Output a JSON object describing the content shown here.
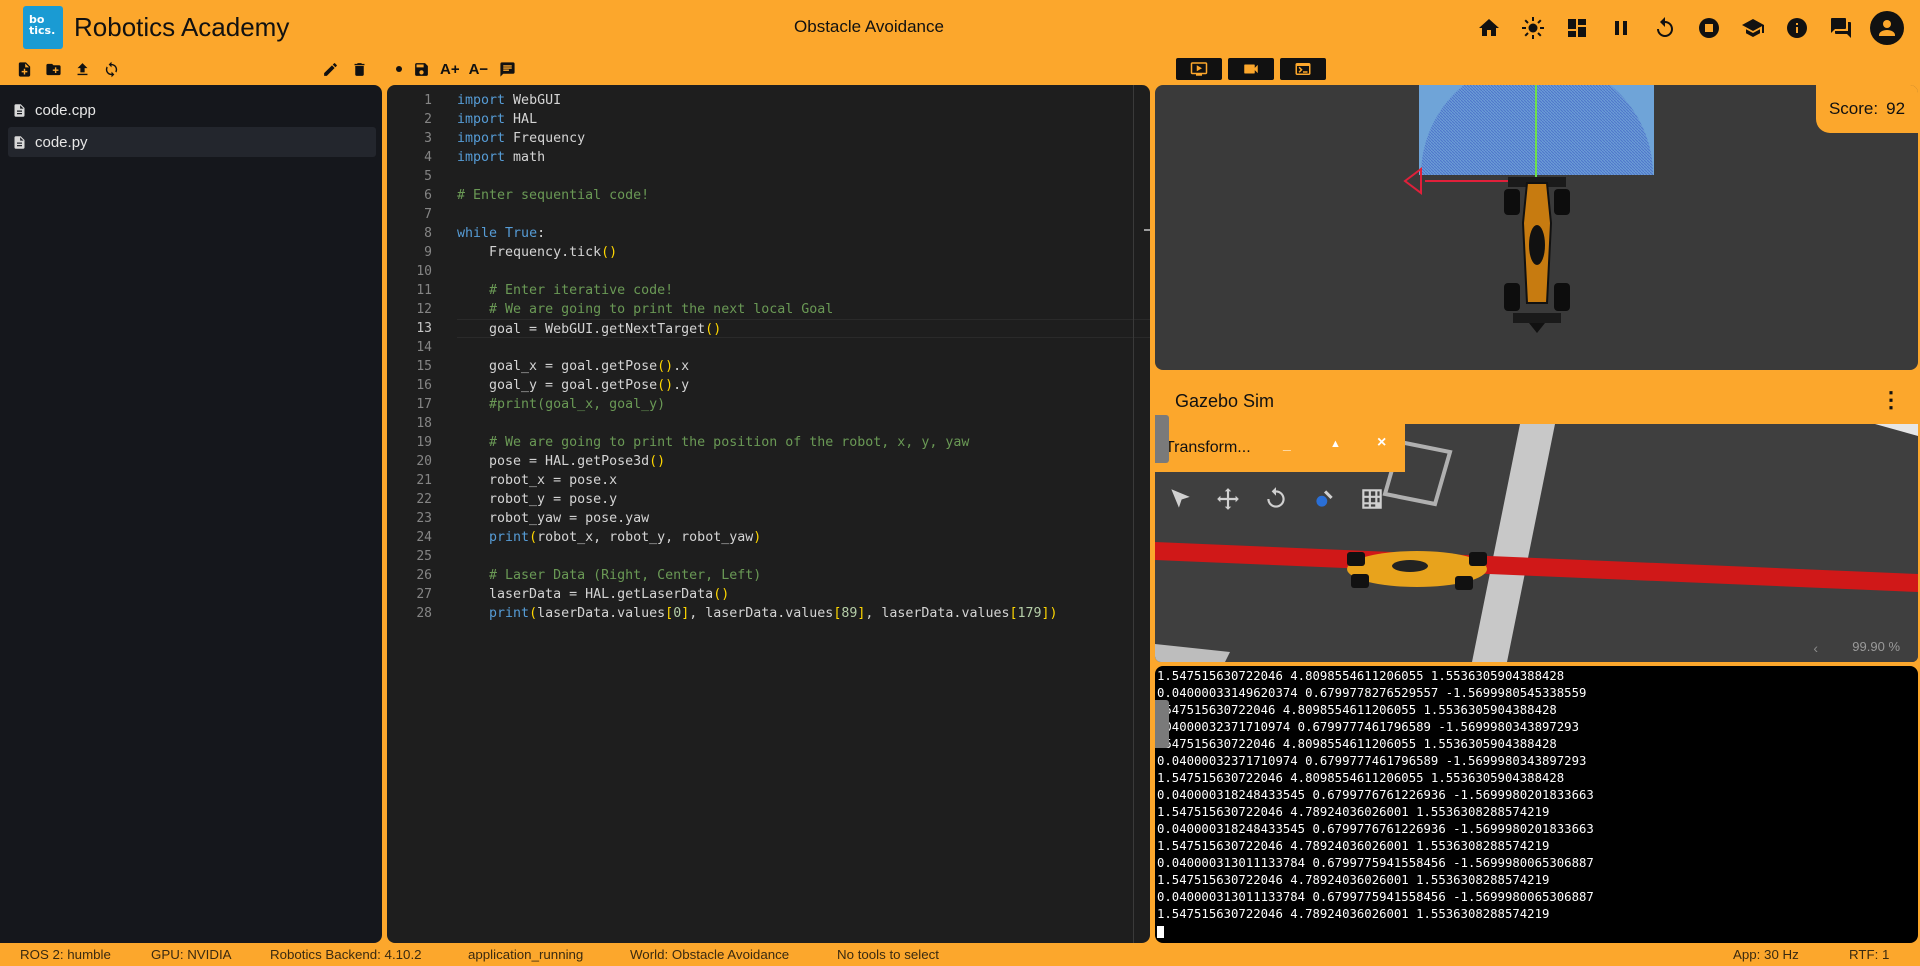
{
  "header": {
    "logo_text": [
      "bo",
      "tics."
    ],
    "app_title": "Robotics Academy",
    "exercise_title": "Obstacle Avoidance",
    "icons": [
      "home-icon",
      "theme-brightness-icon",
      "layout-dashboard-icon",
      "pause-icon",
      "reset-icon",
      "stop-icon",
      "school-icon",
      "info-icon",
      "forum-icon",
      "account-icon"
    ]
  },
  "explorer": {
    "toolbar_icons": [
      "new-file-icon",
      "new-folder-icon",
      "upload-icon",
      "refresh-icon"
    ],
    "right_icons": [
      "edit-icon",
      "delete-icon"
    ],
    "files": [
      {
        "name": "code.cpp",
        "active": false
      },
      {
        "name": "code.py",
        "active": true
      }
    ]
  },
  "editor": {
    "toolbar": {
      "font_increase": "A+",
      "font_decrease": "A−"
    },
    "current_line": 13,
    "lines": [
      "import WebGUI",
      "import HAL",
      "import Frequency",
      "import math",
      "",
      "# Enter sequential code!",
      "",
      "while True:",
      "    Frequency.tick()",
      "",
      "    # Enter iterative code!",
      "    # We are going to print the next local Goal",
      "    goal = WebGUI.getNextTarget()",
      "",
      "    goal_x = goal.getPose().x",
      "    goal_y = goal.getPose().y",
      "    #print(goal_x, goal_y)",
      "",
      "    # We are going to print the position of the robot, x, y, yaw",
      "    pose = HAL.getPose3d()",
      "    robot_x = pose.x",
      "    robot_y = pose.y",
      "    robot_yaw = pose.yaw",
      "    print(robot_x, robot_y, robot_yaw)",
      "",
      "    # Laser Data (Right, Center, Left)",
      "    laserData = HAL.getLaserData()",
      "    print(laserData.values[0], laserData.values[89], laserData.values[179])"
    ]
  },
  "view_toolbar": [
    "monitor-icon",
    "camera-icon",
    "terminal-icon"
  ],
  "score": {
    "label": "Score:",
    "value": "92"
  },
  "gazebo": {
    "title": "Gazebo Sim",
    "transform_panel_title": "Transform...",
    "transform_controls": [
      "_",
      "▲",
      "×"
    ],
    "tools": [
      "select-icon",
      "translate-icon",
      "rotate-icon",
      "spawn-icon",
      "grid-icon"
    ],
    "zoom": "99.90 %"
  },
  "console": {
    "lines": [
      "1.547515630722046 4.8098554611206055 1.5536305904388428",
      "0.04000033149620374 0.6799778276529557 -1.5699980545338559",
      ".547515630722046 4.8098554611206055 1.5536305904388428",
      ".04000032371710974 0.6799777461796589 -1.5699980343897293",
      ".547515630722046 4.8098554611206055 1.5536305904388428",
      "0.04000032371710974 0.6799777461796589 -1.5699980343897293",
      "1.547515630722046 4.8098554611206055 1.5536305904388428",
      "0.040000318248433545 0.6799776761226936 -1.5699980201833663",
      "1.547515630722046 4.78924036026001 1.5536308288574219",
      "0.040000318248433545 0.6799776761226936 -1.5699980201833663",
      "1.547515630722046 4.78924036026001 1.5536308288574219",
      "0.040000313011133784 0.6799775941558456 -1.5699980065306887",
      "1.547515630722046 4.78924036026001 1.5536308288574219",
      "0.040000313011133784 0.6799775941558456 -1.5699980065306887",
      "1.547515630722046 4.78924036026001 1.5536308288574219"
    ]
  },
  "status": {
    "ros": "ROS 2: humble",
    "gpu": "GPU: NVIDIA",
    "backend": "Robotics Backend: 4.10.2",
    "state": "application_running",
    "world": "World: Obstacle Avoidance",
    "tools": "No tools to select",
    "app_freq": "App: 30 Hz",
    "rtf": "RTF: 1"
  }
}
